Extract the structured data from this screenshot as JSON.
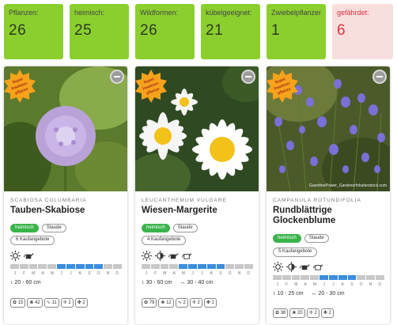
{
  "stats": [
    {
      "label": "Pflanzen:",
      "value": "26",
      "alert": false
    },
    {
      "label": "heimisch:",
      "value": "25",
      "alert": false
    },
    {
      "label": "Wildformen:",
      "value": "26",
      "alert": false
    },
    {
      "label": "kübelgeeignet:",
      "value": "21",
      "alert": false
    },
    {
      "label": "Zwiebelpflanzen:",
      "value": "1",
      "alert": false
    },
    {
      "label": "gefährdet:",
      "value": "6",
      "alert": true
    }
  ],
  "badge_text": [
    "Super",
    "Insekten-",
    "pflanze"
  ],
  "month_letters": [
    "J",
    "F",
    "M",
    "A",
    "M",
    "J",
    "J",
    "A",
    "S",
    "O",
    "N",
    "D"
  ],
  "cards": [
    {
      "latin": "SCABIOSA COLUMBARIA",
      "name": "Tauben-Skabiose",
      "tags": [
        "heimisch",
        "Staude"
      ],
      "shop": "6 Kaufangebote",
      "icons": [
        "sun-icon",
        "watering-can-icon"
      ],
      "bloom": [
        0,
        0,
        0,
        0,
        0,
        1,
        1,
        1,
        1,
        1,
        0,
        0
      ],
      "heights": [
        "20 - 60 cm"
      ],
      "stickers": [
        "15",
        "42",
        "11",
        "2",
        "2"
      ],
      "credit": ""
    },
    {
      "latin": "LEUCANTHEMUM VULGARE",
      "name": "Wiesen-Margerite",
      "tags": [
        "heimisch",
        "Staude"
      ],
      "shop": "4 Kaufangebote",
      "icons": [
        "sun-icon",
        "half-shade-icon",
        "watering-can-icon",
        "watering-can-outline-icon"
      ],
      "bloom": [
        0,
        0,
        0,
        0,
        1,
        1,
        1,
        1,
        1,
        0,
        0,
        0
      ],
      "heights": [
        "30 - 60 cm",
        "30 - 40 cm"
      ],
      "stickers": [
        "79",
        "12",
        "2",
        "2",
        "2"
      ],
      "credit": ""
    },
    {
      "latin": "CAMPANULA ROTUNDIFOLIA",
      "name": "Rundblättrige Glockenblume",
      "tags": [
        "heimisch",
        "Staude"
      ],
      "shop": "5 Kaufangebote",
      "icons": [
        "sun-icon",
        "half-shade-icon",
        "watering-can-icon",
        "watering-can-outline-icon"
      ],
      "bloom": [
        0,
        0,
        0,
        0,
        0,
        1,
        1,
        1,
        1,
        0,
        0,
        0
      ],
      "heights": [
        "10 - 25 cm",
        "20 - 30 cm"
      ],
      "stickers": [
        "38",
        "20",
        "2",
        "2"
      ],
      "credit": "GuentherPower_Gardenorfshutterstock.com"
    }
  ]
}
